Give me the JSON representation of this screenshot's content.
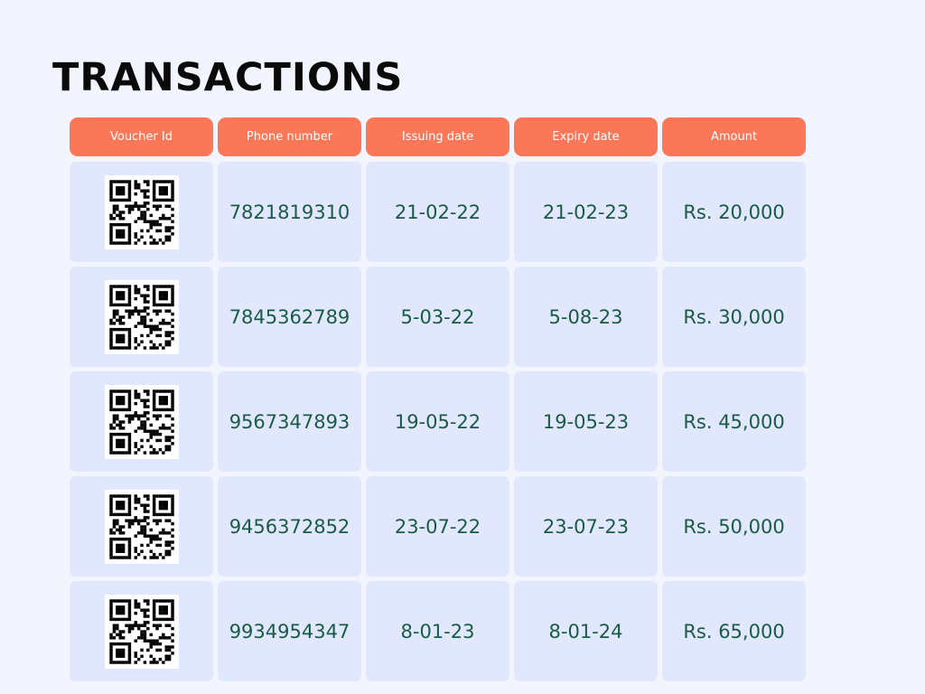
{
  "page": {
    "title": "TRANSACTIONS"
  },
  "table": {
    "headers": [
      "Voucher Id",
      "Phone number",
      "Issuing date",
      "Expiry date",
      "Amount"
    ],
    "rows": [
      {
        "voucher_icon": "qr-code-icon",
        "phone": "7821819310",
        "issuing": "21-02-22",
        "expiry": "21-02-23",
        "amount": "Rs. 20,000"
      },
      {
        "voucher_icon": "qr-code-icon",
        "phone": "7845362789",
        "issuing": "5-03-22",
        "expiry": "5-08-23",
        "amount": "Rs. 30,000"
      },
      {
        "voucher_icon": "qr-code-icon",
        "phone": "9567347893",
        "issuing": "19-05-22",
        "expiry": "19-05-23",
        "amount": "Rs. 45,000"
      },
      {
        "voucher_icon": "qr-code-icon",
        "phone": "9456372852",
        "issuing": "23-07-22",
        "expiry": "23-07-23",
        "amount": "Rs. 50,000"
      },
      {
        "voucher_icon": "qr-code-icon",
        "phone": "9934954347",
        "issuing": "8-01-23",
        "expiry": "8-01-24",
        "amount": "Rs. 65,000"
      }
    ]
  },
  "colors": {
    "background": "#f2f5fe",
    "header": "#fa7758",
    "cell": "#e1e7fc",
    "cell_text": "#1a5b47",
    "title_text": "#0a0a0a"
  }
}
